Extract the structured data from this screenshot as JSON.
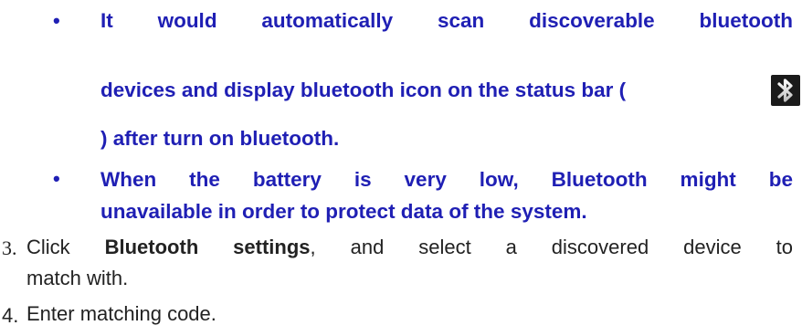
{
  "bullets": [
    {
      "symbol": "•",
      "line1": "It would automatically scan discoverable bluetooth",
      "line2": "devices and display bluetooth icon on the status bar (",
      "line3": ") after turn on bluetooth."
    },
    {
      "symbol": "•",
      "line1": "When the battery is very low, Bluetooth might be",
      "line2": "unavailable in order to protect data of the system."
    }
  ],
  "icons": {
    "status_bar_bluetooth": "bluetooth-icon"
  },
  "steps": [
    {
      "number": "3.",
      "line1_prefix": "Click ",
      "line1_bold": "Bluetooth settings",
      "line1_suffix": ", and select a discovered device to",
      "line2": "match with."
    },
    {
      "number": "4.",
      "line1": "Enter matching code."
    }
  ],
  "colors": {
    "bullet_text": "#1f1fb4",
    "body_text": "#222222"
  }
}
